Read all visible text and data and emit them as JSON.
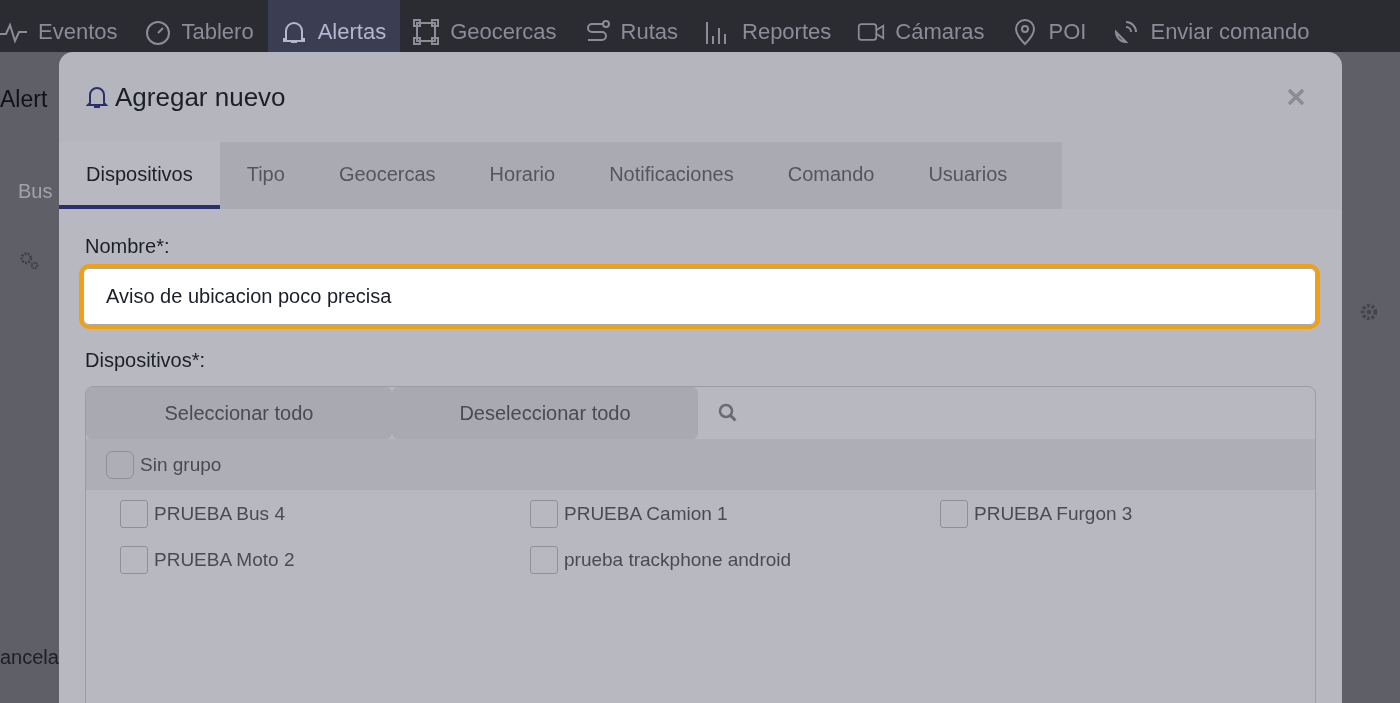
{
  "nav": {
    "items": [
      {
        "label": "Eventos",
        "selected": false
      },
      {
        "label": "Tablero",
        "selected": false
      },
      {
        "label": "Alertas",
        "selected": true
      },
      {
        "label": "Geocercas",
        "selected": false
      },
      {
        "label": "Rutas",
        "selected": false
      },
      {
        "label": "Reportes",
        "selected": false
      },
      {
        "label": "Cámaras",
        "selected": false
      },
      {
        "label": "POI",
        "selected": false
      },
      {
        "label": "Enviar comando",
        "selected": false
      }
    ]
  },
  "background_page": {
    "title": "Alert",
    "search": {
      "placeholder": "Bus"
    },
    "cancel_button": "ancela"
  },
  "modal": {
    "title": "Agregar nuevo",
    "tabs": [
      {
        "label": "Dispositivos",
        "selected": true
      },
      {
        "label": "Tipo",
        "selected": false
      },
      {
        "label": "Geocercas",
        "selected": false
      },
      {
        "label": "Horario",
        "selected": false
      },
      {
        "label": "Notificaciones",
        "selected": false
      },
      {
        "label": "Comando",
        "selected": false
      },
      {
        "label": "Usuarios",
        "selected": false
      }
    ],
    "name_field": {
      "label": "Nombre*:",
      "value": "Aviso de ubicacion poco precisa",
      "focused": true
    },
    "devices": {
      "label": "Dispositivos*:",
      "select_all": "Seleccionar todo",
      "deselect_all": "Deseleccionar todo",
      "groups": [
        {
          "name": "Sin grupo",
          "checked": false,
          "devices": [
            {
              "name": "PRUEBA Bus 4",
              "checked": false
            },
            {
              "name": "PRUEBA Camion 1",
              "checked": false
            },
            {
              "name": "PRUEBA Furgon 3",
              "checked": false
            },
            {
              "name": "PRUEBA Moto 2",
              "checked": false
            },
            {
              "name": "prueba trackphone android",
              "checked": false
            }
          ]
        }
      ]
    }
  }
}
